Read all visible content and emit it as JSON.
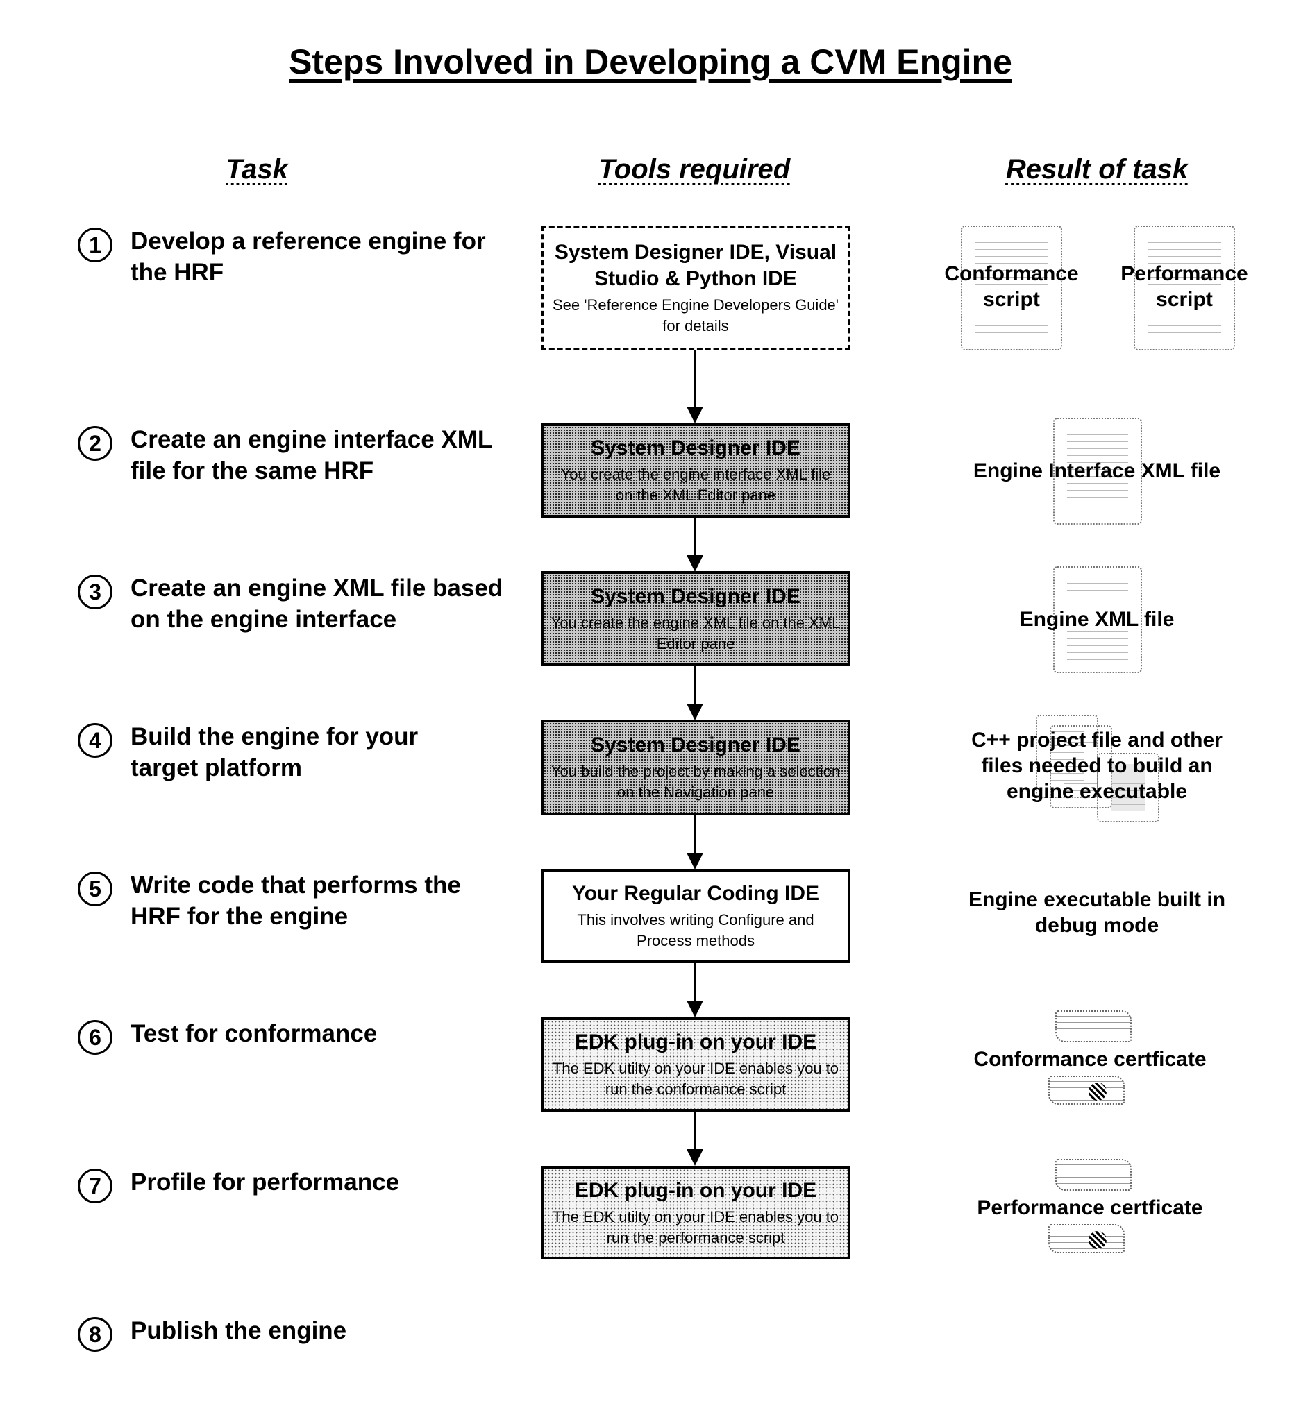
{
  "title": "Steps Involved in Developing a CVM Engine",
  "column_headers": {
    "task": "Task",
    "tools": "Tools required",
    "result": "Result of task"
  },
  "steps": [
    {
      "number": "1",
      "task": "Develop a reference engine for the HRF"
    },
    {
      "number": "2",
      "task": "Create an engine interface XML file for the same HRF"
    },
    {
      "number": "3",
      "task": "Create an engine XML file based on the engine interface"
    },
    {
      "number": "4",
      "task": "Build the engine for your target platform"
    },
    {
      "number": "5",
      "task": "Write code that performs the HRF for the engine"
    },
    {
      "number": "6",
      "task": "Test for conformance"
    },
    {
      "number": "7",
      "task": "Profile for performance"
    },
    {
      "number": "8",
      "task": "Publish the engine"
    }
  ],
  "tools": [
    {
      "title": "System Designer IDE, Visual Studio & Python IDE",
      "desc": "See 'Reference Engine Developers Guide' for details",
      "style": "dashed"
    },
    {
      "title": "System Designer IDE",
      "desc": "You create the engine interface XML file on the XML Editor pane",
      "style": "dense"
    },
    {
      "title": "System Designer IDE",
      "desc": "You create the engine XML file on the XML Editor pane",
      "style": "dense"
    },
    {
      "title": "System Designer IDE",
      "desc": "You build the project by making a selection on the Navigation pane",
      "style": "dense"
    },
    {
      "title": "Your Regular Coding IDE",
      "desc": "This involves writing Configure and Process methods",
      "style": "plain"
    },
    {
      "title": "EDK plug-in on your IDE",
      "desc": "The EDK utilty on your IDE enables you to run the conformance script",
      "style": "light"
    },
    {
      "title": "EDK plug-in on your IDE",
      "desc": "The EDK utilty on your IDE enables you to run the performance script",
      "style": "light"
    }
  ],
  "results": {
    "r1a": "Conformance script",
    "r1b": "Performance script",
    "r2": "Engine Interface XML file",
    "r3": "Engine XML file",
    "r4": "C++ project file and other files needed to build an engine executable",
    "r5": "Engine executable built in debug mode",
    "r6": "Conformance certficate",
    "r7": "Performance certficate"
  },
  "icons": {
    "script": "document-icon",
    "xml": "xml-document-icon",
    "project": "file-stack-icon",
    "certificate": "certificate-icon"
  }
}
